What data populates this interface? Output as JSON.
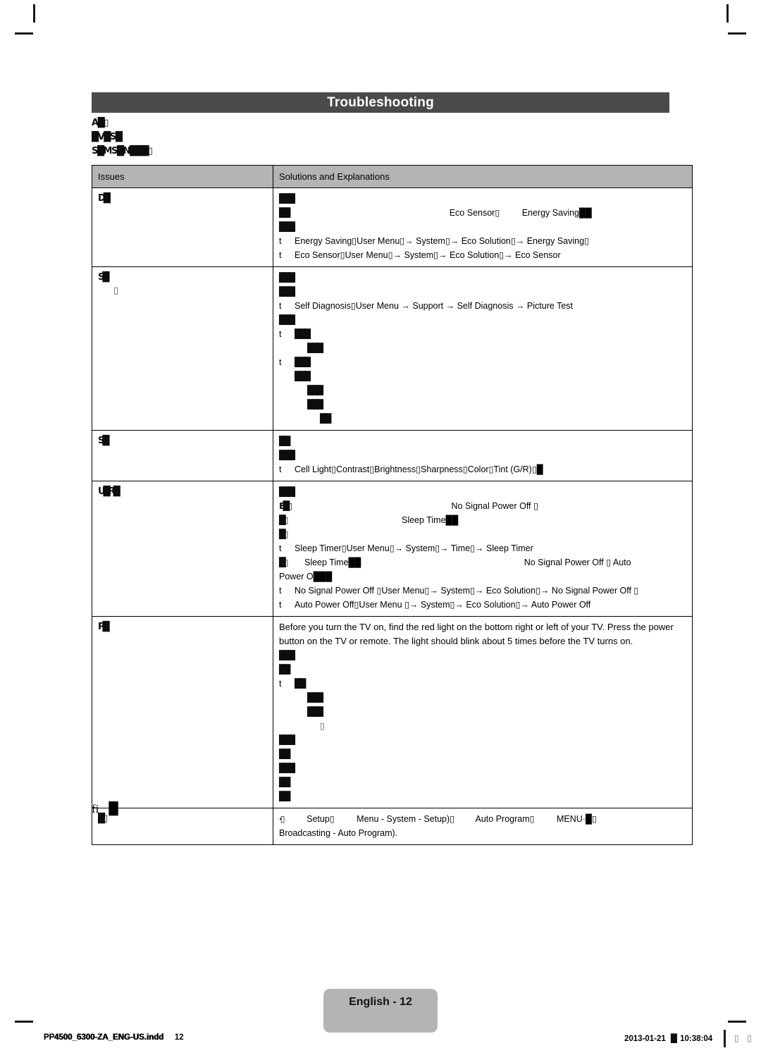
{
  "document": {
    "title": "Troubleshooting",
    "page_label": "English - 12"
  },
  "intro_lines": [
    {
      "text": "A█▯"
    },
    {
      "text": "█V█S█"
    },
    {
      "text": "S█MS█N███▯"
    }
  ],
  "table": {
    "headers": {
      "issues": "Issues",
      "solutions": "Solutions and Explanations"
    },
    "rows": [
      {
        "issue": "D█",
        "lines": [
          {
            "type": "glyph",
            "indent": 0,
            "text": "███"
          },
          {
            "type": "mixed",
            "indent": 0,
            "lead": "██",
            "push": "mid",
            "text": "Eco Sensor▯",
            "gap": "Energy Saving██"
          },
          {
            "type": "glyph",
            "indent": 0,
            "text": "███"
          },
          {
            "type": "bullet",
            "mark": "t",
            "text": "Energy Saving▯User Menu▯→ System▯→ Eco Solution▯→ Energy Saving▯"
          },
          {
            "type": "bullet",
            "mark": "t",
            "text": "Eco Sensor▯User Menu▯→ System▯→ Eco Solution▯→ Eco Sensor"
          }
        ]
      },
      {
        "issue": "S█",
        "issue_sub": "▯",
        "lines": [
          {
            "type": "glyph",
            "indent": 0,
            "text": "███"
          },
          {
            "type": "glyph",
            "indent": 0,
            "text": "███"
          },
          {
            "type": "bullet",
            "mark": "t",
            "text": "Self Diagnosis▯User Menu → Support → Self Diagnosis → Picture Test"
          },
          {
            "type": "glyph",
            "indent": 0,
            "text": "███"
          },
          {
            "type": "bullet",
            "mark": "t",
            "text": "███"
          },
          {
            "type": "glyph",
            "indent": 2,
            "text": "███"
          },
          {
            "type": "bullet",
            "mark": "t",
            "text": "███"
          },
          {
            "type": "glyph",
            "indent": 1,
            "text": "███"
          },
          {
            "type": "glyph",
            "indent": 2,
            "text": "███"
          },
          {
            "type": "glyph",
            "indent": 2,
            "text": "███"
          },
          {
            "type": "glyph",
            "indent": 3,
            "text": "██"
          }
        ]
      },
      {
        "issue": "S█",
        "lines": [
          {
            "type": "glyph",
            "indent": 0,
            "text": "██"
          },
          {
            "type": "glyph",
            "indent": 0,
            "text": "███"
          },
          {
            "type": "bullet",
            "mark": "t",
            "text": "Cell Light▯Contrast▯Brightness▯Sharpness▯Color▯Tint (G/R)▯█"
          }
        ]
      },
      {
        "issue": "U█R█",
        "lines": [
          {
            "type": "glyph",
            "indent": 0,
            "text": "███"
          },
          {
            "type": "mixed",
            "indent": 0,
            "lead": "E█▯",
            "push": "mid",
            "text": "No Signal Power Off ▯",
            "gap": ""
          },
          {
            "type": "mixed",
            "indent": 0,
            "lead": "█▯",
            "push": "mid2",
            "text": "Sleep Time██",
            "gap": ""
          },
          {
            "type": "glyph",
            "indent": 0,
            "text": "█▯"
          },
          {
            "type": "bullet",
            "mark": "t",
            "text": "Sleep Timer▯User Menu▯→ System▯→ Time▯→ Sleep Timer"
          },
          {
            "type": "wrap",
            "lead": "█▯",
            "first": "Sleep Time██",
            "tail": "No Signal Power Off ▯ Auto",
            "second": "Power O███"
          },
          {
            "type": "bullet",
            "mark": "t",
            "text": "No Signal Power Off ▯User Menu▯→ System▯→ Eco Solution▯→ No Signal Power Off ▯"
          },
          {
            "type": "bullet",
            "mark": "t",
            "text": "Auto Power Off▯User Menu ▯→ System▯→ Eco Solution▯→ Auto Power Off"
          }
        ]
      },
      {
        "issue": "P█",
        "paragraph": "Before you turn the TV on, find the red light on the bottom right or left of your TV. Press the power button on the TV or remote. The light should blink about 5 times before the TV turns on.",
        "lines": [
          {
            "type": "glyph",
            "indent": 0,
            "text": "███"
          },
          {
            "type": "glyph",
            "indent": 0,
            "text": "██"
          },
          {
            "type": "bullet",
            "mark": "t",
            "text": "██"
          },
          {
            "type": "glyph",
            "indent": 2,
            "text": "███"
          },
          {
            "type": "glyph",
            "indent": 2,
            "text": "███"
          },
          {
            "type": "glyph",
            "indent": 3,
            "text": "▯"
          },
          {
            "type": "glyph",
            "indent": 0,
            "text": "███"
          },
          {
            "type": "glyph",
            "indent": 0,
            "text": "██"
          },
          {
            "type": "glyph",
            "indent": 0,
            "text": "███"
          },
          {
            "type": "glyph",
            "indent": 0,
            "text": "██"
          },
          {
            "type": "glyph",
            "indent": 0,
            "text": "██"
          }
        ]
      },
      {
        "issue": "█▯",
        "lines": [
          {
            "type": "setup",
            "lead": "·▯",
            "a": "Setup▯",
            "b": "Menu - System - Setup)▯",
            "c": "Auto Program▯",
            "d": "MENU·█▯"
          },
          {
            "type": "plain",
            "text": "Broadcasting - Auto Program)."
          }
        ]
      }
    ]
  },
  "post_table_mark": {
    "ligature": "fi",
    "box": "█"
  },
  "footer": {
    "filename_overlay_a": "PP4500_5300-ZA_ENG-US.indd",
    "filename_overlay_b": "PF4500_6300-ZA_ENG-US.indd",
    "page_number": "12",
    "date": "2013-01-21",
    "separator_glyph": "█",
    "time": "10:38:04",
    "trailing_glyphs": "▯ ▯"
  },
  "colors": {
    "title_bar": "#4a4a4a",
    "header_row": "#b4b4b4",
    "badge": "#b4b4b4",
    "text": "#000000",
    "page": "#ffffff"
  }
}
